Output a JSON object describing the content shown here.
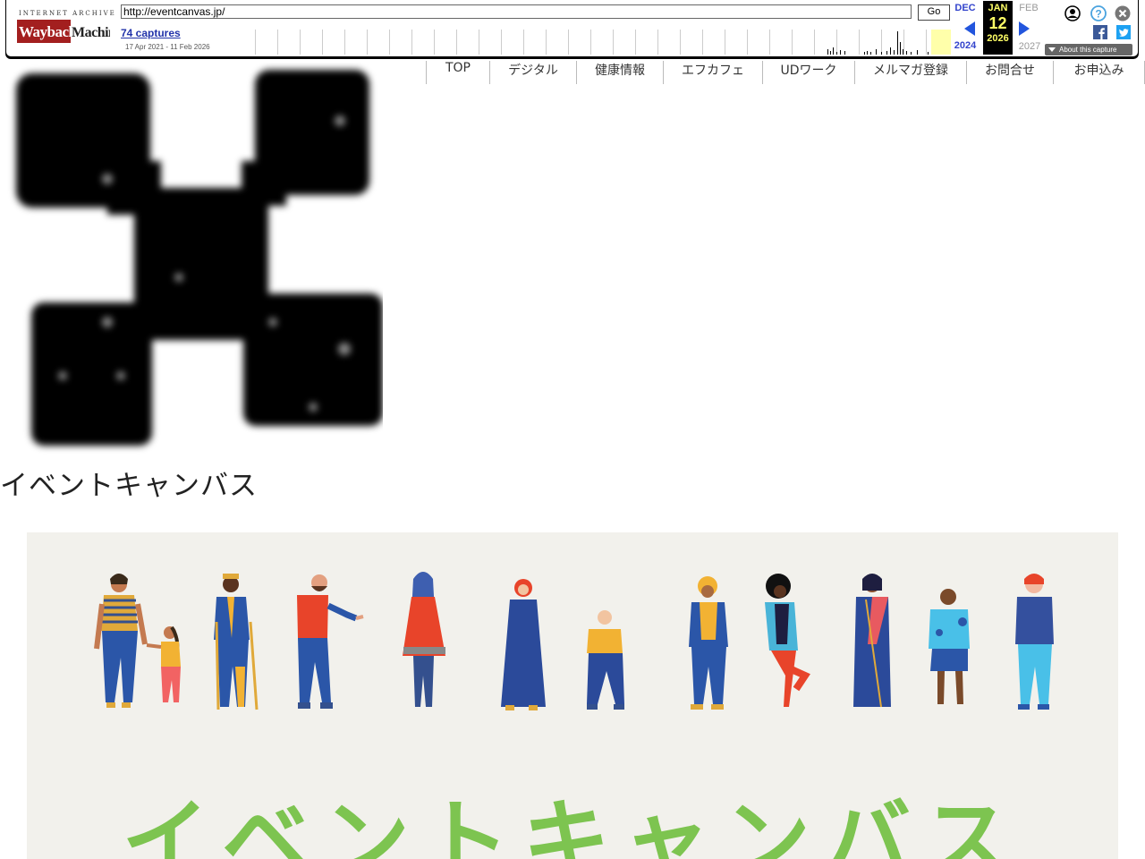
{
  "wayback": {
    "logo_top": "INTERNET ARCHIVE",
    "logo_main": "WaybackMachine",
    "url": "http://eventcanvas.jp/",
    "go_label": "Go",
    "captures": "74 captures",
    "range": "17 Apr 2021 - 11 Feb 2026",
    "prev_month": "DEC",
    "cur_month": "JAN",
    "cur_day": "12",
    "cur_year": "2026",
    "next_month": "FEB",
    "prev_year": "2024",
    "next_year": "2027",
    "about": "About this capture",
    "colors": {
      "link": "#2233aa",
      "highlight": "#ffff66",
      "arrow": "#2255dd"
    }
  },
  "nav": {
    "items": [
      "TOP",
      "デジタル",
      "健康情報",
      "エフカフェ",
      "UDワーク",
      "メルマガ登録",
      "お問合せ",
      "お申込み"
    ]
  },
  "site": {
    "title": "イベントキャンバス"
  },
  "hero": {
    "title": "イベントキャンバス",
    "accent": "#7dc450",
    "background": "#f2f1ec"
  }
}
